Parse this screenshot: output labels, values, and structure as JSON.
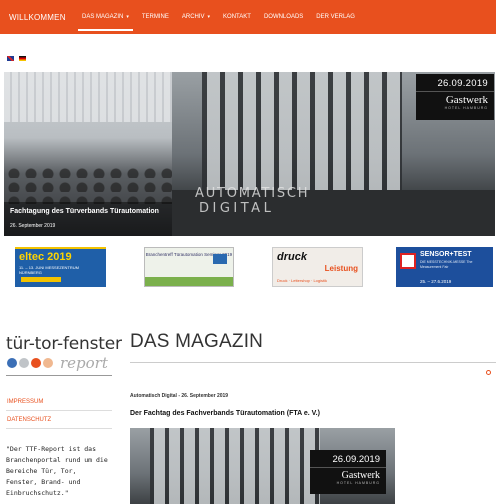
{
  "nav": {
    "brand": "WILLKOMMEN",
    "items": [
      {
        "label": "DAS MAGAZIN",
        "caret": "▾",
        "active": true
      },
      {
        "label": "TERMINE",
        "caret": "",
        "active": false
      },
      {
        "label": "ARCHIV",
        "caret": "▾",
        "active": false
      },
      {
        "label": "KONTAKT",
        "caret": "",
        "active": false
      },
      {
        "label": "DOWNLOADS",
        "caret": "",
        "active": false
      },
      {
        "label": "DER VERLAG",
        "caret": "",
        "active": false
      }
    ],
    "color": "#e8501e"
  },
  "languages": [
    "flag-uk",
    "flag-de"
  ],
  "hero": {
    "title": "Fachtagung des Türverbands Türautomation",
    "date": "26. September 2019",
    "overlay_line1": "AUTOMATISCH",
    "overlay_line2": "DIGITAL",
    "event_date": "26.09.2019",
    "event_venue": "Gastwerk",
    "event_sub": "HOTEL HAMBURG"
  },
  "banners": {
    "eltec": {
      "title": "eltec 2019",
      "sub": "11. – 13. JUNI MESSEZENTRUM NÜRNBERG",
      "strip": "Jetzt Stand sichern"
    },
    "seminar": {
      "title": "Branchentreff Türautomation Seminar 2019"
    },
    "druck": {
      "title": "druck",
      "highlight": "Leistung",
      "sub": "Druck · Lettershop · Logistik"
    },
    "sensor": {
      "title": "SENSOR+TEST",
      "sub": "DIE MESSTECHNIK-MESSE The Measurement Fair",
      "date": "25. – 27.6.2019"
    }
  },
  "logo": {
    "text": "tür-tor-fenster",
    "report": "report",
    "dots": [
      "#3b6fb6",
      "#c0c4c8",
      "#e8501e",
      "#f0b890"
    ]
  },
  "sidebar": {
    "impressum": "IMPRESSUM",
    "datenschutz": "DATENSCHUTZ",
    "description_lines": [
      "\"Der TTF-Report ist das",
      "Branchenportal rund um die",
      "Bereiche  Tür,  Tor,",
      "Fenster, Brand- und",
      "Einbruchschutz.\""
    ]
  },
  "main": {
    "page_title": "DAS MAGAZIN",
    "gear_icon": "gear-icon",
    "article_meta": "Automatisch Digital - 26. September 2019",
    "article_title": "Der Fachtag des Fachverbands Türautomation (FTA e. V.)",
    "article_event_date": "26.09.2019",
    "article_event_venue": "Gastwerk",
    "article_event_sub": "HOTEL HAMBURG"
  }
}
